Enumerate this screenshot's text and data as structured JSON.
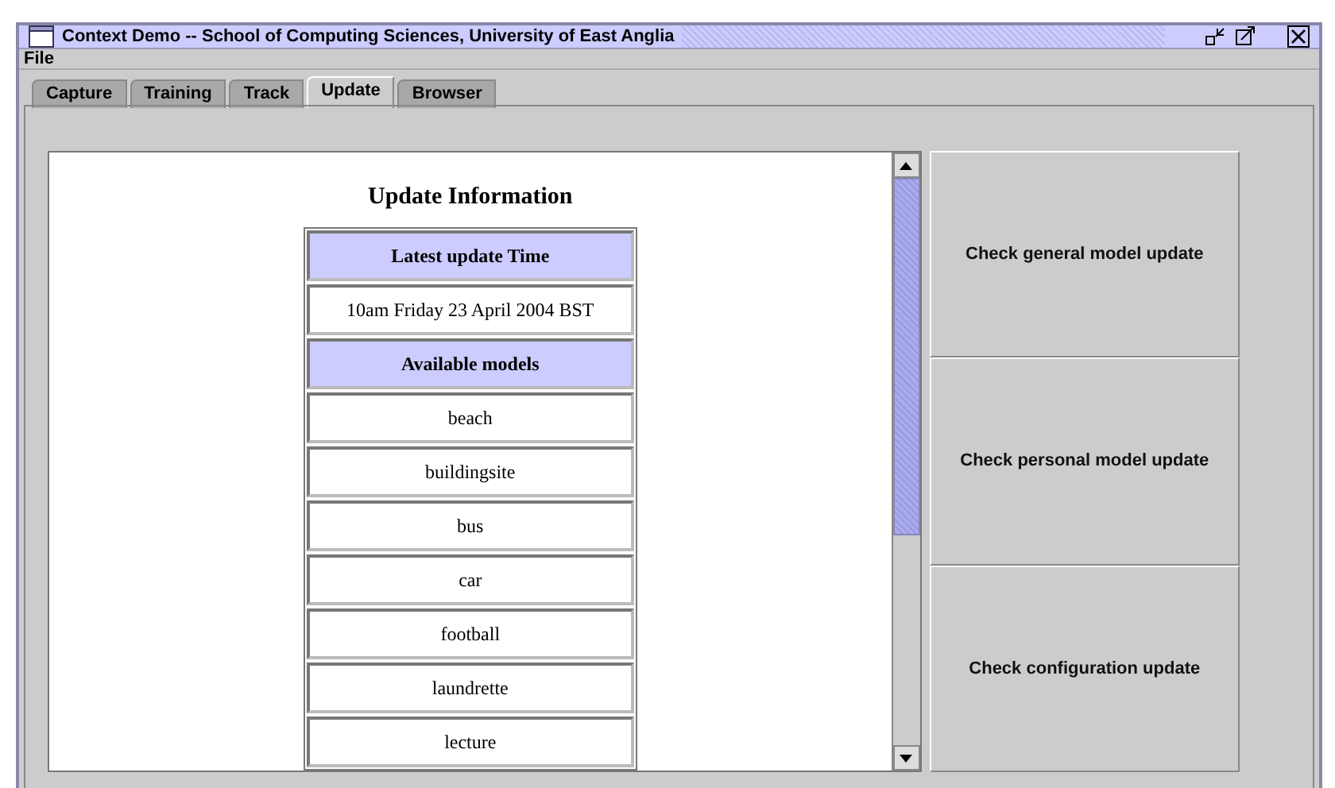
{
  "window": {
    "title": "Context Demo -- School of Computing Sciences, University of East Anglia"
  },
  "menu": [
    "File"
  ],
  "tabs": [
    {
      "label": "Capture",
      "selected": false
    },
    {
      "label": "Training",
      "selected": false
    },
    {
      "label": "Track",
      "selected": false
    },
    {
      "label": "Update",
      "selected": true
    },
    {
      "label": "Browser",
      "selected": false
    }
  ],
  "document": {
    "heading": "Update Information",
    "table": [
      {
        "kind": "header",
        "text": "Latest update Time"
      },
      {
        "kind": "cell",
        "text": "10am Friday 23 April 2004 BST"
      },
      {
        "kind": "header",
        "text": "Available models"
      },
      {
        "kind": "cell",
        "text": "beach"
      },
      {
        "kind": "cell",
        "text": "buildingsite"
      },
      {
        "kind": "cell",
        "text": "bus"
      },
      {
        "kind": "cell",
        "text": "car"
      },
      {
        "kind": "cell",
        "text": "football"
      },
      {
        "kind": "cell",
        "text": "laundrette"
      },
      {
        "kind": "cell",
        "text": "lecture"
      }
    ]
  },
  "buttons": [
    "Check general model update",
    "Check personal model update",
    "Check configuration update"
  ]
}
